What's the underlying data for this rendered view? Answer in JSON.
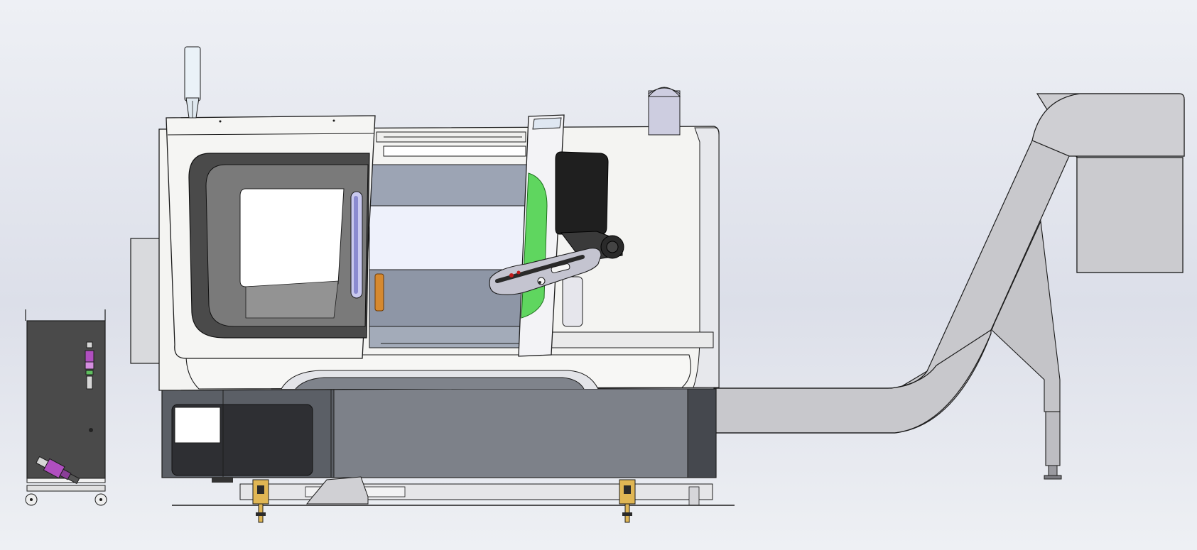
{
  "scene": {
    "kind": "cad-render",
    "background": {
      "top": "#eef0f5",
      "mid": "#dcdfe9",
      "bottom": "#eef0f4"
    },
    "palette": {
      "outline": "#1c1c1c",
      "enclosure": "#f4f4f2",
      "enclosure_shade": "#c9ccd4",
      "door_frame": "#4a4a4a",
      "window_glass": "#ffffff",
      "interior": "#8e96a6",
      "base": "#5b5f66",
      "base_dark": "#2e2f33",
      "accent_green": "#5fd65f",
      "conveyor": "#c8c8cc",
      "pendant": "#bcbcc8",
      "brass": "#e0b654",
      "magenta": "#b04fc0"
    },
    "icons": [
      "signal-tower-icon",
      "chip-conveyor-icon",
      "control-panel-icon",
      "coolant-tank-icon",
      "leveling-foot-icon"
    ]
  }
}
